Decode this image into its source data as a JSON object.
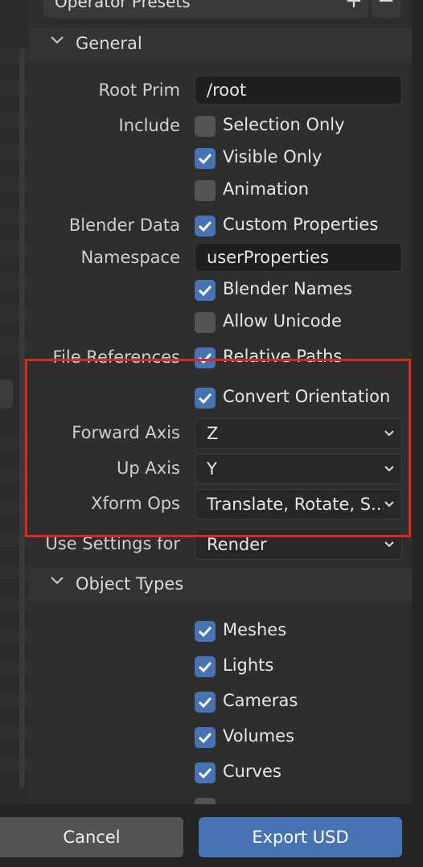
{
  "presets": {
    "label": "Operator Presets"
  },
  "general": {
    "title": "General",
    "root_prim": {
      "label": "Root Prim",
      "value": "/root"
    },
    "include_label": "Include",
    "selection_only": {
      "label": "Selection Only",
      "checked": false
    },
    "visible_only": {
      "label": "Visible Only",
      "checked": true
    },
    "animation": {
      "label": "Animation",
      "checked": false
    },
    "blender_data_label": "Blender Data",
    "custom_properties": {
      "label": "Custom Properties",
      "checked": true
    },
    "namespace": {
      "label": "Namespace",
      "value": "userProperties"
    },
    "blender_names": {
      "label": "Blender Names",
      "checked": true
    },
    "allow_unicode": {
      "label": "Allow Unicode",
      "checked": false
    },
    "file_references_label": "File References",
    "relative_paths": {
      "label": "Relative Paths",
      "checked": true
    },
    "convert_orientation": {
      "label": "Convert Orientation",
      "checked": true
    },
    "forward_axis": {
      "label": "Forward Axis",
      "value": "Z"
    },
    "up_axis": {
      "label": "Up Axis",
      "value": "Y"
    },
    "xform_ops": {
      "label": "Xform Ops",
      "value": "Translate, Rotate, S..."
    },
    "use_settings_for": {
      "label": "Use Settings for",
      "value": "Render"
    }
  },
  "object_types": {
    "title": "Object Types",
    "meshes": {
      "label": "Meshes",
      "checked": true
    },
    "lights": {
      "label": "Lights",
      "checked": true
    },
    "cameras": {
      "label": "Cameras",
      "checked": true
    },
    "volumes": {
      "label": "Volumes",
      "checked": true
    },
    "curves": {
      "label": "Curves",
      "checked": true
    }
  },
  "buttons": {
    "cancel": "Cancel",
    "export": "Export USD"
  },
  "colors": {
    "accent": "#4772b3",
    "highlight": "#e02616",
    "panel": "#2e2e2e"
  }
}
